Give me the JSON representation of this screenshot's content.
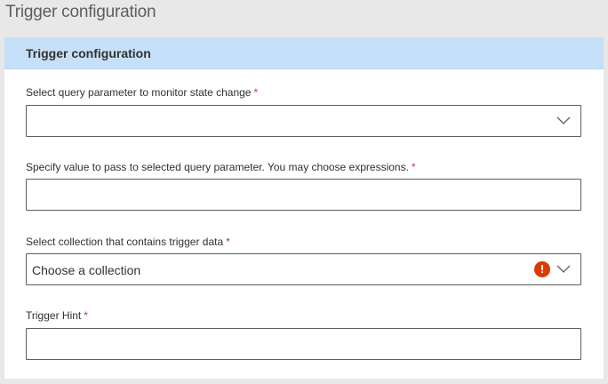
{
  "page": {
    "title": "Trigger configuration"
  },
  "panel": {
    "header_title": "Trigger configuration",
    "fields": [
      {
        "label": "Select query parameter to monitor state change",
        "required_marker": "*",
        "type": "dropdown",
        "value": "",
        "icon": "chevron-down-icon"
      },
      {
        "label": "Specify value to pass to selected query parameter. You may choose expressions.",
        "required_marker": "*",
        "type": "text",
        "value": ""
      },
      {
        "label": "Select collection that contains trigger data",
        "required_marker": "*",
        "type": "dropdown",
        "value": "Choose a collection",
        "icons": [
          "error-icon",
          "chevron-down-icon"
        ],
        "error_glyph": "!"
      },
      {
        "label": "Trigger Hint",
        "required_marker": "*",
        "type": "text",
        "value": ""
      }
    ]
  },
  "colors": {
    "header_bg": "#c7e0f9",
    "required": "#c4314b",
    "error": "#d83b01"
  }
}
